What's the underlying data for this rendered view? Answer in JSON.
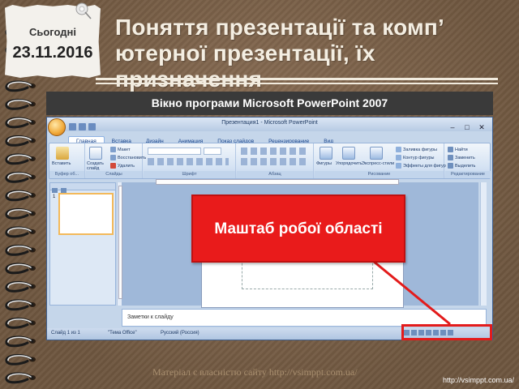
{
  "date_note": {
    "label": "Сьогодні",
    "date": "23.11.2016"
  },
  "title": {
    "line1": "Поняття презентації та комп’",
    "line2": "ютерної презентації, їх",
    "line3": "призначення"
  },
  "caption": "Вікно програми Microsoft PowerPoint 2007",
  "window": {
    "title": "Презентация1 - Microsoft PowerPoint",
    "controls": [
      "–",
      "□",
      "✕"
    ],
    "tabs": [
      "Главная",
      "Вставка",
      "Дизайн",
      "Анимация",
      "Показ слайдов",
      "Рецензирование",
      "Вид"
    ],
    "ribbon": {
      "groups": [
        {
          "label": "Буфер об...",
          "buttons": [
            "Вставить"
          ]
        },
        {
          "label": "Слайды",
          "buttons": [
            "Создать слайд",
            "Макет",
            "Восстановить",
            "Удалить"
          ]
        },
        {
          "label": "Шрифт",
          "buttons": []
        },
        {
          "label": "Абзац",
          "buttons": []
        },
        {
          "label": "Рисование",
          "buttons": [
            "Фигуры",
            "Упорядочить",
            "Экспресс-стили",
            "Заливка фигуры",
            "Контур фигуры",
            "Эффекты для фигур"
          ]
        },
        {
          "label": "Редактирование",
          "buttons": [
            "Найти",
            "Заменить",
            "Выделить"
          ]
        }
      ]
    },
    "thumbnail_number": "1",
    "notes_placeholder": "Заметки к слайду",
    "status": {
      "slide": "Слайд 1 из 1",
      "theme": "\"Тема Office\"",
      "language": "Русский (Россия)"
    }
  },
  "callout": "Маштаб робої області",
  "footer": {
    "source": "Матеріал є власністю сайту http://vsimppt.com.ua/",
    "url": "http://vsimppt.com.ua/"
  },
  "colors": {
    "background": "#7a604a",
    "accent_red": "#e91b1b",
    "title_text": "#f4eee2"
  }
}
